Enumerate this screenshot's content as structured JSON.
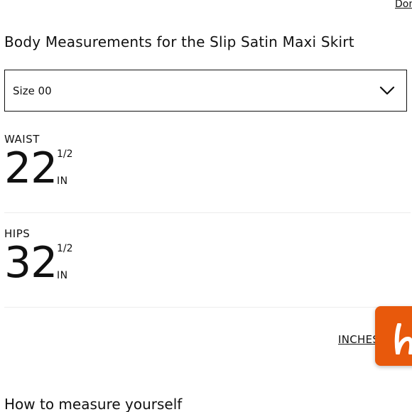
{
  "header": {
    "top_link_label": "Don",
    "title": "Body Measurements for the Slip Satin Maxi Skirt"
  },
  "size_select": {
    "value": "Size 00"
  },
  "measurements": [
    {
      "label": "WAIST",
      "whole": "22",
      "fraction": "1/2",
      "unit": "IN"
    },
    {
      "label": "HIPS",
      "whole": "32",
      "fraction": "1/2",
      "unit": "IN"
    }
  ],
  "units_toggle_label": "INCHES",
  "brand_widget": {
    "icon": "honey-h-logo",
    "color": "#e8590c"
  },
  "how_to_heading": "How to measure yourself"
}
